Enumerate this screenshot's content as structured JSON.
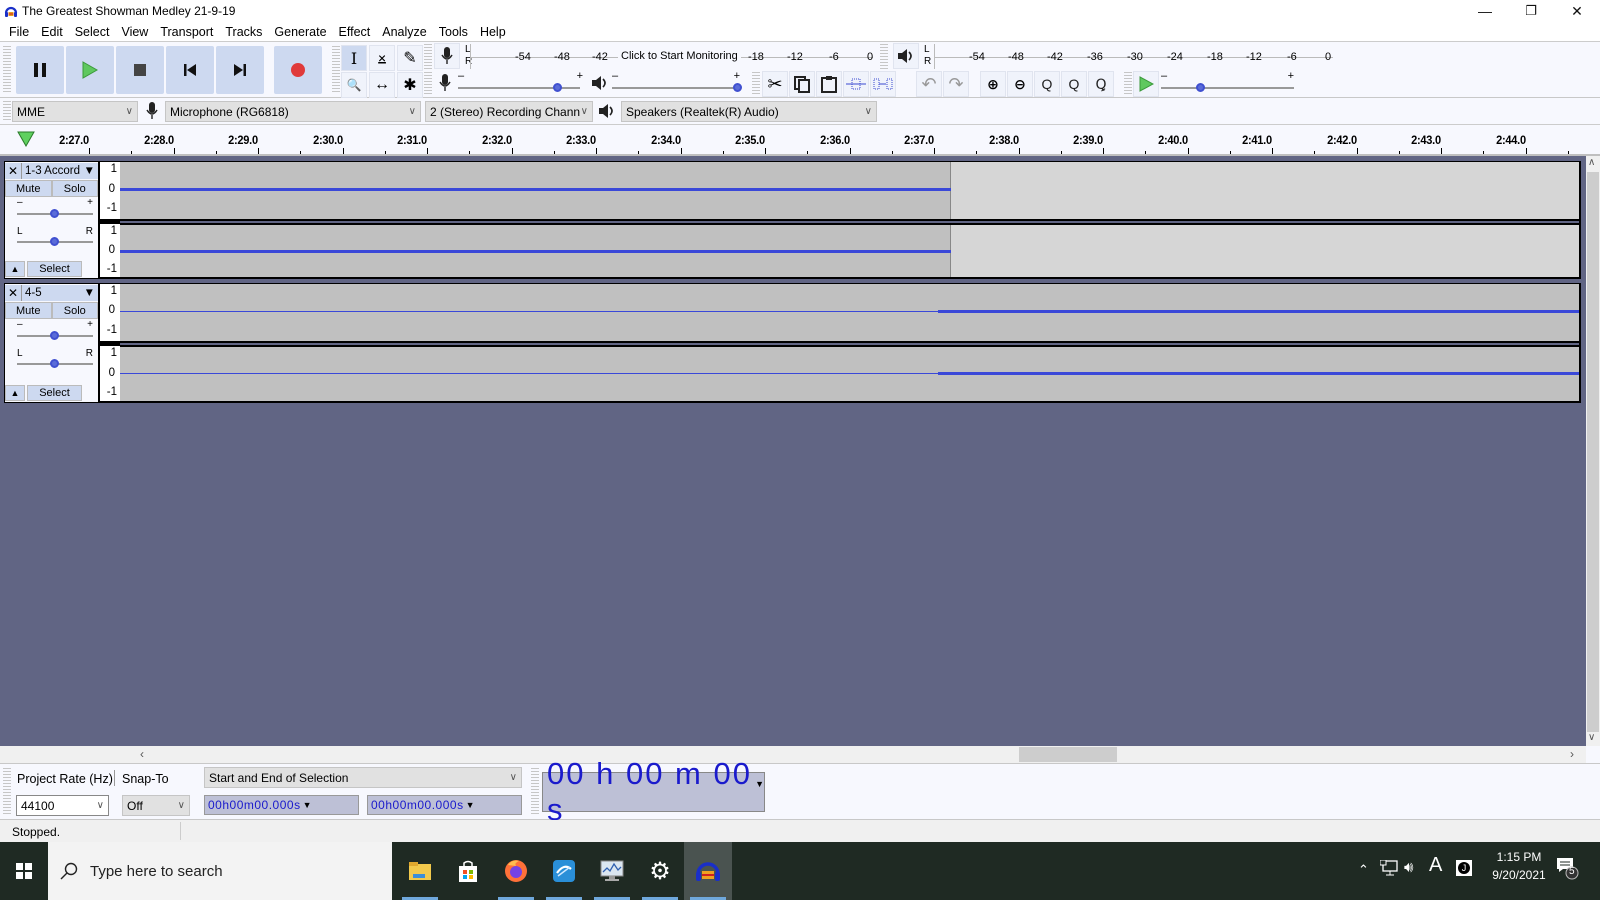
{
  "window": {
    "title": "The Greatest Showman Medley 21-9-19",
    "controls": {
      "minimize": "—",
      "restore": "❐",
      "close": "✕"
    }
  },
  "menu": [
    "File",
    "Edit",
    "Select",
    "View",
    "Transport",
    "Tracks",
    "Generate",
    "Effect",
    "Analyze",
    "Tools",
    "Help"
  ],
  "transport": {
    "buttons": [
      {
        "name": "pause-button",
        "icon": "pause-icon"
      },
      {
        "name": "play-button",
        "icon": "play-icon"
      },
      {
        "name": "stop-button",
        "icon": "stop-icon"
      },
      {
        "name": "skip-to-start-button",
        "icon": "skip-start-icon"
      },
      {
        "name": "skip-to-end-button",
        "icon": "skip-end-icon"
      },
      {
        "name": "record-button",
        "icon": "record-icon"
      }
    ]
  },
  "tools": {
    "row1": [
      "I",
      "⨱",
      "✎"
    ],
    "row2": [
      "🔍",
      "↔",
      "✱"
    ]
  },
  "recording_meter": {
    "lr": [
      "L",
      "R"
    ],
    "ticks": [
      "-54",
      "-48",
      "-42",
      "-18",
      "-12",
      "-6",
      "0"
    ],
    "prompt": "Click to Start Monitoring"
  },
  "playback_meter": {
    "lr": [
      "L",
      "R"
    ],
    "ticks": [
      "-54",
      "-48",
      "-42",
      "-36",
      "-30",
      "-24",
      "-18",
      "-12",
      "-6",
      "0"
    ]
  },
  "mixer": {
    "record_volume": 0.85,
    "playback_volume": 1.0,
    "minus": "–",
    "plus": "+"
  },
  "play_at_speed": {
    "speed": 0.3,
    "minus": "–",
    "plus": "+"
  },
  "devices": {
    "host": "MME",
    "input": "Microphone (RG6818)",
    "channels": "2 (Stereo) Recording Chann",
    "output": "Speakers (Realtek(R) Audio)"
  },
  "timeline": {
    "labels": [
      "2:27.0",
      "2:28.0",
      "2:29.0",
      "2:30.0",
      "2:31.0",
      "2:32.0",
      "2:33.0",
      "2:34.0",
      "2:35.0",
      "2:36.0",
      "2:37.0",
      "2:38.0",
      "2:39.0",
      "2:40.0",
      "2:41.0",
      "2:42.0",
      "2:43.0",
      "2:44.0"
    ]
  },
  "tracks": [
    {
      "name": "1-3 Accord",
      "mute": "Mute",
      "solo": "Solo",
      "select": "Select",
      "gain_label_minus": "–",
      "gain_label_plus": "+",
      "pan_left": "L",
      "pan_right": "R",
      "gain": 0.5,
      "pan": 0.5,
      "scale": [
        "1",
        "0",
        "-1"
      ],
      "clip_end_time": "2:37.1"
    },
    {
      "name": "4-5",
      "mute": "Mute",
      "solo": "Solo",
      "select": "Select",
      "gain_label_minus": "–",
      "gain_label_plus": "+",
      "pan_left": "L",
      "pan_right": "R",
      "gain": 0.5,
      "pan": 0.5,
      "scale": [
        "1",
        "0",
        "-1"
      ],
      "audio_start_time": "2:37.0"
    }
  ],
  "selection": {
    "project_rate_label": "Project Rate (Hz)",
    "project_rate": "44100",
    "snap_to_label": "Snap-To",
    "snap_to": "Off",
    "mode": "Start and End of Selection",
    "start": "00h00m00.000s",
    "end": "00h00m00.000s",
    "audio_position": "00 h 00 m 00 s"
  },
  "status": "Stopped.",
  "taskbar": {
    "search_placeholder": "Type here to search",
    "apps": [
      "file-explorer",
      "microsoft-store",
      "firefox",
      "app-blue",
      "task-manager",
      "settings",
      "audacity"
    ],
    "time": "1:15 PM",
    "date": "9/20/2021",
    "notifications": "5",
    "ime": "A"
  }
}
